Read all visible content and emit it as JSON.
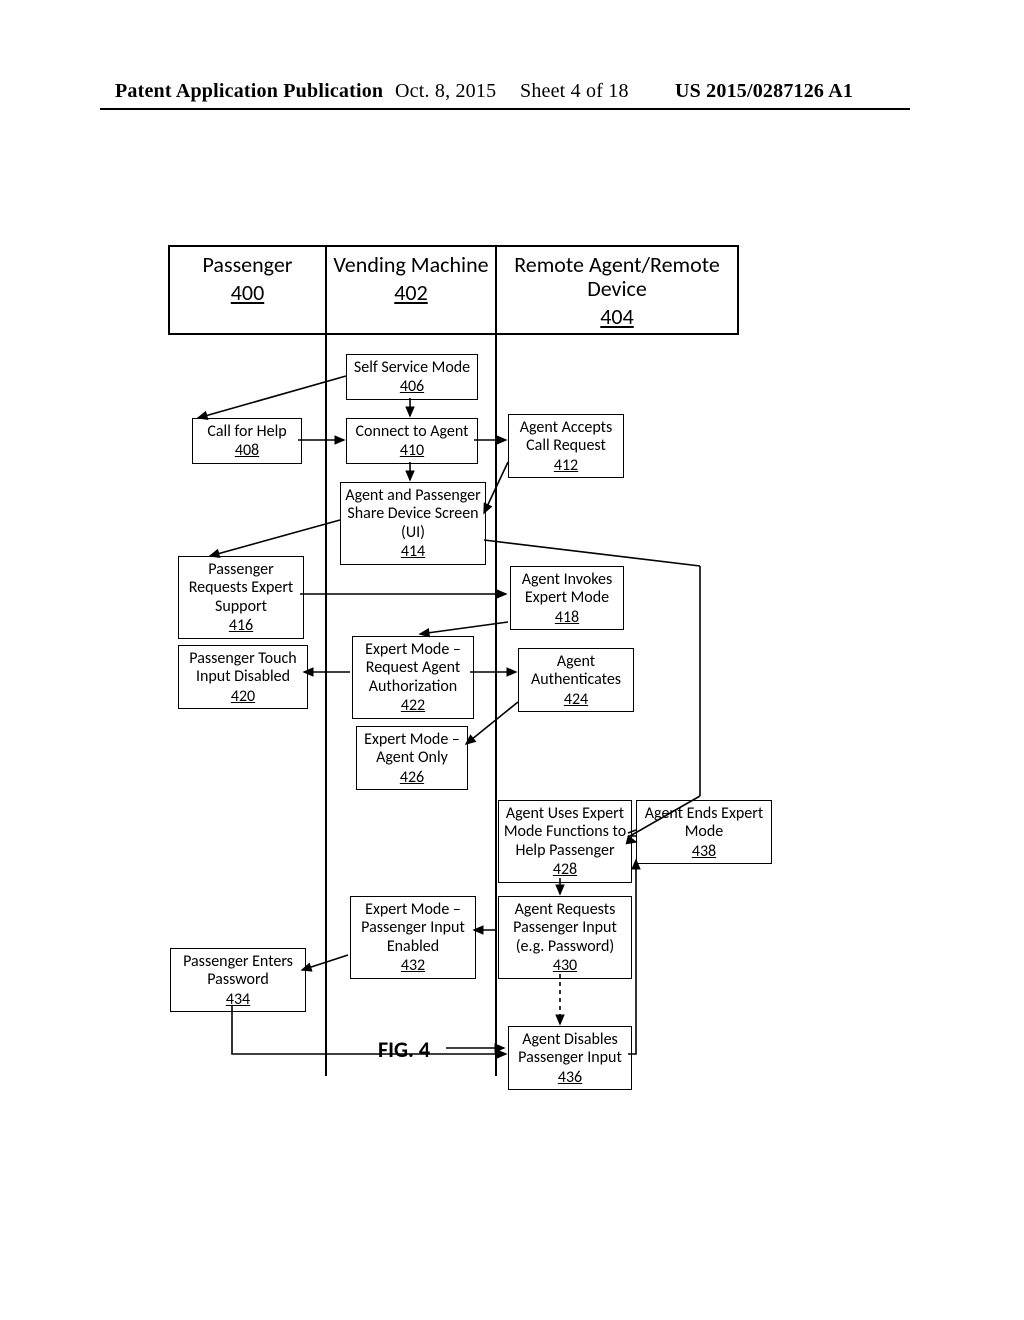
{
  "header": {
    "left": "Patent Application Publication",
    "date": "Oct. 8, 2015",
    "sheet": "Sheet 4 of 18",
    "pubno": "US 2015/0287126 A1"
  },
  "lanes": {
    "passenger": {
      "title": "Passenger",
      "ref": "400"
    },
    "vending": {
      "title": "Vending Machine",
      "ref": "402"
    },
    "remote": {
      "title": "Remote Agent/Remote Device",
      "ref": "404"
    }
  },
  "boxes": {
    "b406": {
      "title": "Self Service Mode",
      "ref": "406"
    },
    "b408": {
      "title": "Call for Help",
      "ref": "408"
    },
    "b410": {
      "title": "Connect to Agent",
      "ref": "410"
    },
    "b412": {
      "title": "Agent Accepts Call Request",
      "ref": "412"
    },
    "b414": {
      "title": "Agent and Passenger Share Device Screen (UI)",
      "ref": "414"
    },
    "b416": {
      "title": "Passenger Requests Expert Support",
      "ref": "416"
    },
    "b418": {
      "title": "Agent Invokes Expert Mode",
      "ref": "418"
    },
    "b420": {
      "title": "Passenger Touch Input Disabled",
      "ref": "420"
    },
    "b422": {
      "title": "Expert Mode – Request Agent Authorization",
      "ref": "422"
    },
    "b424": {
      "title": "Agent Authenticates",
      "ref": "424"
    },
    "b426": {
      "title": "Expert Mode – Agent Only",
      "ref": "426"
    },
    "b428": {
      "title": "Agent Uses Expert Mode Functions to Help Passenger",
      "ref": "428"
    },
    "b430": {
      "title": "Agent Requests Passenger Input (e.g. Password)",
      "ref": "430"
    },
    "b432": {
      "title": "Expert Mode – Passenger Input Enabled",
      "ref": "432"
    },
    "b434": {
      "title": "Passenger Enters Password",
      "ref": "434"
    },
    "b436": {
      "title": "Agent Disables Passenger Input",
      "ref": "436"
    },
    "b438": {
      "title": "Agent Ends Expert Mode",
      "ref": "438"
    }
  },
  "figure": "FIG. 4"
}
